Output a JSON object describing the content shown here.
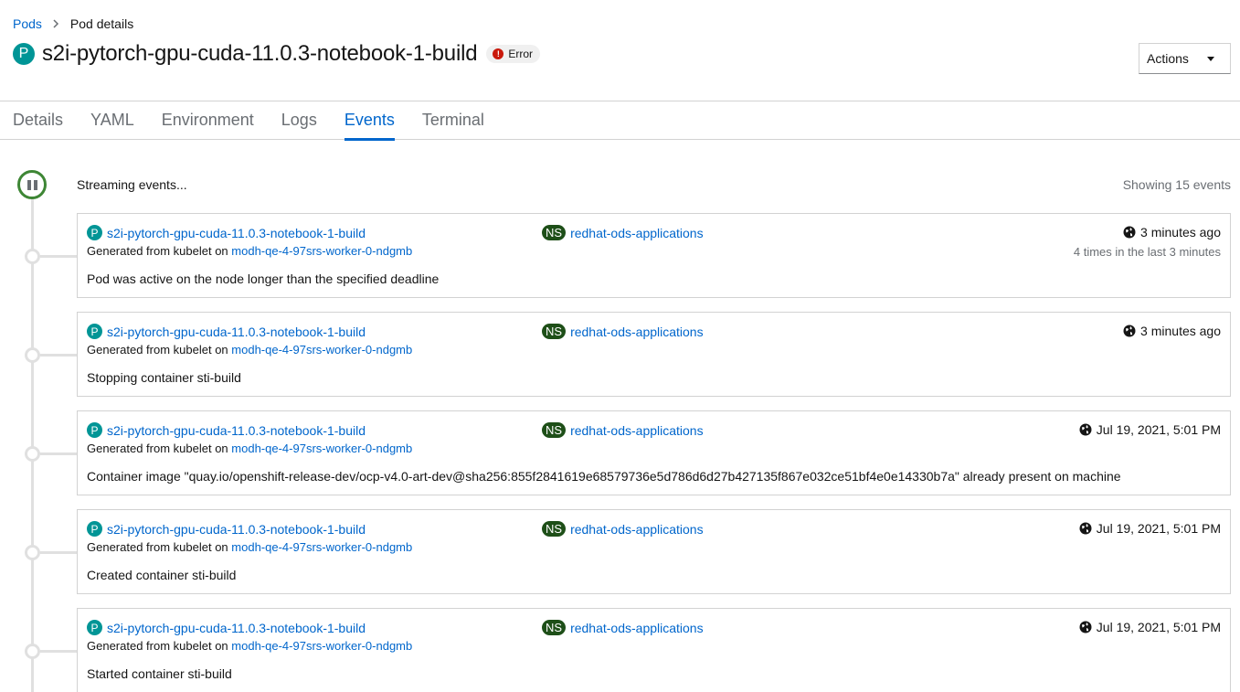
{
  "breadcrumb": {
    "parent": "Pods",
    "current": "Pod details"
  },
  "header": {
    "badge": "P",
    "title": "s2i-pytorch-gpu-cuda-11.0.3-notebook-1-build",
    "status": "Error",
    "status_icon": "exclamation-circle-icon",
    "status_color": "#c9190b",
    "actions_label": "Actions"
  },
  "tabs": [
    "Details",
    "YAML",
    "Environment",
    "Logs",
    "Events",
    "Terminal"
  ],
  "active_tab": "Events",
  "stream": {
    "status": "Streaming events...",
    "count_text": "Showing 15 events"
  },
  "events": [
    {
      "badge": "P",
      "resource": "s2i-pytorch-gpu-cuda-11.0.3-notebook-1-build",
      "generated_prefix": "Generated from kubelet on",
      "node": "modh-qe-4-97srs-worker-0-ndgmb",
      "ns_badge": "NS",
      "namespace": "redhat-ods-applications",
      "time": "3 minutes ago",
      "count": "4 times in the last 3 minutes",
      "message": "Pod was active on the node longer than the specified deadline"
    },
    {
      "badge": "P",
      "resource": "s2i-pytorch-gpu-cuda-11.0.3-notebook-1-build",
      "generated_prefix": "Generated from kubelet on",
      "node": "modh-qe-4-97srs-worker-0-ndgmb",
      "ns_badge": "NS",
      "namespace": "redhat-ods-applications",
      "time": "3 minutes ago",
      "message": "Stopping container sti-build"
    },
    {
      "badge": "P",
      "resource": "s2i-pytorch-gpu-cuda-11.0.3-notebook-1-build",
      "generated_prefix": "Generated from kubelet on",
      "node": "modh-qe-4-97srs-worker-0-ndgmb",
      "ns_badge": "NS",
      "namespace": "redhat-ods-applications",
      "time": "Jul 19, 2021, 5:01 PM",
      "message": "Container image \"quay.io/openshift-release-dev/ocp-v4.0-art-dev@sha256:855f2841619e68579736e5d786d6d27b427135f867e032ce51bf4e0e14330b7a\" already present on machine"
    },
    {
      "badge": "P",
      "resource": "s2i-pytorch-gpu-cuda-11.0.3-notebook-1-build",
      "generated_prefix": "Generated from kubelet on",
      "node": "modh-qe-4-97srs-worker-0-ndgmb",
      "ns_badge": "NS",
      "namespace": "redhat-ods-applications",
      "time": "Jul 19, 2021, 5:01 PM",
      "message": "Created container sti-build"
    },
    {
      "badge": "P",
      "resource": "s2i-pytorch-gpu-cuda-11.0.3-notebook-1-build",
      "generated_prefix": "Generated from kubelet on",
      "node": "modh-qe-4-97srs-worker-0-ndgmb",
      "ns_badge": "NS",
      "namespace": "redhat-ods-applications",
      "time": "Jul 19, 2021, 5:01 PM",
      "message": "Started container sti-build"
    }
  ],
  "colors": {
    "link": "#0066cc",
    "pod_badge": "#009596",
    "ns_badge": "#1e4f18",
    "streaming_ring": "#3e8635"
  }
}
